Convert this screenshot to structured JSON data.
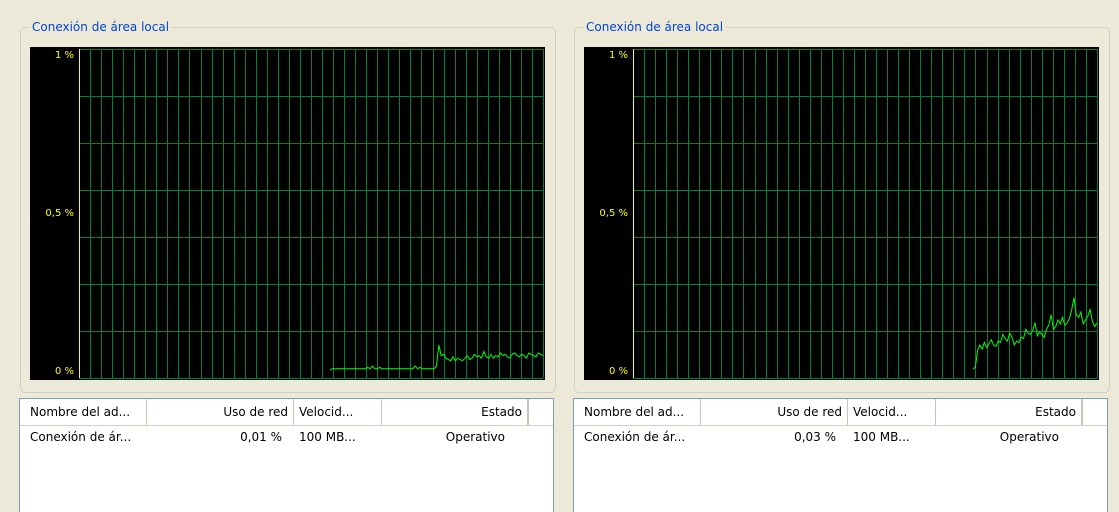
{
  "panels": [
    {
      "title": "Conexión de área local",
      "axis": {
        "top": "1 %",
        "mid": "0,5 %",
        "bottom": "0 %"
      },
      "usage_trace": [
        0,
        0,
        0,
        0,
        0,
        0,
        0,
        0,
        0,
        0,
        0,
        0,
        0,
        0,
        0,
        0,
        0,
        0,
        0,
        0,
        0,
        0,
        0,
        0,
        0,
        0,
        0,
        0,
        0,
        0,
        0,
        0,
        0,
        0,
        0,
        0,
        0,
        0,
        0,
        0,
        0,
        0,
        0,
        0,
        0,
        0,
        0,
        0,
        0,
        0,
        0,
        0,
        0,
        0,
        0,
        0,
        0,
        0,
        0,
        0,
        0,
        0,
        0,
        0,
        0,
        0,
        0,
        0,
        0,
        0,
        0,
        0,
        0,
        0,
        0,
        0,
        0,
        0,
        0,
        0,
        0,
        0,
        0,
        0,
        0,
        0,
        0,
        0,
        0,
        0,
        0,
        0,
        0,
        0,
        0,
        0,
        0,
        0,
        0,
        0,
        0,
        0,
        0,
        0,
        0,
        0,
        0.003,
        0.004,
        0.004,
        0.004,
        0.004,
        0.004,
        0.004,
        0.004,
        0.004,
        0.004,
        0.004,
        0.004,
        0.004,
        0.004,
        0.004,
        0.004,
        0.005,
        0.004,
        0.006,
        0.004,
        0.004,
        0.005,
        0.004,
        0.004,
        0.004,
        0.004,
        0.004,
        0.004,
        0.004,
        0.004,
        0.004,
        0.004,
        0.004,
        0.004,
        0.004,
        0.004,
        0.006,
        0.004,
        0.005,
        0.004,
        0.004,
        0.004,
        0.004,
        0.004,
        0.004,
        0.006,
        0.022,
        0.014,
        0.015,
        0.012,
        0.011,
        0.01,
        0.013,
        0.01,
        0.012,
        0.011,
        0.01,
        0.012,
        0.014,
        0.011,
        0.012,
        0.015,
        0.013,
        0.014,
        0.012,
        0.017,
        0.013,
        0.012,
        0.015,
        0.012,
        0.014,
        0.013,
        0.016,
        0.014,
        0.015,
        0.013,
        0.012,
        0.015,
        0.016,
        0.014,
        0.013,
        0.015,
        0.014,
        0.012,
        0.016,
        0.015,
        0.014,
        0.013,
        0.016,
        0.015,
        0.014
      ],
      "table": {
        "headers": [
          "Nombre del ad...",
          "Uso de red",
          "Velocid...",
          "Estado"
        ],
        "rows": [
          [
            "Conexión de ár...",
            "0,01 %",
            "100 MB...",
            "Operativo"
          ]
        ]
      }
    },
    {
      "title": "Conexión de área local",
      "axis": {
        "top": "1 %",
        "mid": "0,5 %",
        "bottom": "0 %"
      },
      "usage_trace": [
        0,
        0,
        0,
        0,
        0,
        0,
        0,
        0,
        0,
        0,
        0,
        0,
        0,
        0,
        0,
        0,
        0,
        0,
        0,
        0,
        0,
        0,
        0,
        0,
        0,
        0,
        0,
        0,
        0,
        0,
        0,
        0,
        0,
        0,
        0,
        0,
        0,
        0,
        0,
        0,
        0,
        0,
        0,
        0,
        0,
        0,
        0,
        0,
        0,
        0,
        0,
        0,
        0,
        0,
        0,
        0,
        0,
        0,
        0,
        0,
        0,
        0,
        0,
        0,
        0,
        0,
        0,
        0,
        0,
        0,
        0,
        0,
        0,
        0,
        0,
        0,
        0,
        0,
        0,
        0,
        0,
        0,
        0,
        0,
        0,
        0,
        0,
        0,
        0,
        0,
        0,
        0,
        0,
        0,
        0,
        0,
        0,
        0,
        0,
        0,
        0,
        0,
        0,
        0,
        0,
        0,
        0,
        0,
        0,
        0,
        0,
        0,
        0,
        0,
        0,
        0,
        0,
        0,
        0,
        0,
        0,
        0,
        0,
        0,
        0,
        0,
        0,
        0,
        0,
        0,
        0,
        0,
        0,
        0,
        0,
        0,
        0,
        0,
        0,
        0,
        0,
        0,
        0,
        0,
        0,
        0,
        0,
        0,
        0.004,
        0.005,
        0.018,
        0.022,
        0.019,
        0.024,
        0.02,
        0.023,
        0.026,
        0.022,
        0.021,
        0.025,
        0.024,
        0.03,
        0.027,
        0.025,
        0.031,
        0.028,
        0.022,
        0.025,
        0.024,
        0.028,
        0.027,
        0.034,
        0.031,
        0.03,
        0.033,
        0.039,
        0.029,
        0.032,
        0.03,
        0.028,
        0.034,
        0.037,
        0.045,
        0.034,
        0.036,
        0.041,
        0.038,
        0.043,
        0.037,
        0.039,
        0.042,
        0.049,
        0.058,
        0.045,
        0.043,
        0.047,
        0.038,
        0.041,
        0.044,
        0.049,
        0.04,
        0.036,
        0.039
      ],
      "table": {
        "headers": [
          "Nombre del ad...",
          "Uso de red",
          "Velocid...",
          "Estado"
        ],
        "rows": [
          [
            "Conexión de ár...",
            "0,03 %",
            "100 MB...",
            "Operativo"
          ]
        ]
      }
    }
  ],
  "colors": {
    "grid": "#008040",
    "axis": "#ffff00",
    "trace": "#00ff00",
    "title": "#0046d5"
  }
}
